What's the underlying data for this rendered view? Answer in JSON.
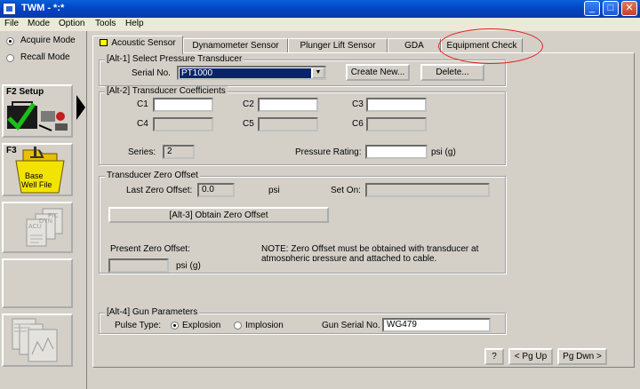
{
  "window": {
    "title": "TWM - *:*",
    "min": "_",
    "max": "□",
    "close": "✕"
  },
  "menu": [
    "File",
    "Mode",
    "Option",
    "Tools",
    "Help"
  ],
  "sidebar": {
    "acquire_label": "Acquire Mode",
    "recall_label": "Recall Mode",
    "setup_label": "F2 Setup",
    "basewell_key": "F3",
    "basewell_label_1": "Base",
    "basewell_label_2": "Well File"
  },
  "tabs": [
    "Acoustic Sensor",
    "Dynamometer Sensor",
    "Plunger Lift Sensor",
    "GDA",
    "Equipment Check"
  ],
  "pressure": {
    "legend": "[Alt-1]  Select Pressure Transducer",
    "serial_label": "Serial No.",
    "serial_value": "PT1000",
    "create_button": "Create New...",
    "delete_button": "Delete..."
  },
  "coefficients": {
    "legend": "[Alt-2]  Transducer Coefficients",
    "c1": "C1",
    "c2": "C2",
    "c3": "C3",
    "c4": "C4",
    "c5": "C5",
    "c6": "C6",
    "series_label": "Series:",
    "series_value": "2",
    "rating_label": "Pressure Rating:",
    "rating_unit": "psi (g)"
  },
  "zero_offset": {
    "legend": "Transducer Zero Offset",
    "last_label": "Last Zero Offset:",
    "last_value": "0.0",
    "last_unit": "psi",
    "set_on_label": "Set On:",
    "obtain_button": "[Alt-3]  Obtain Zero Offset",
    "present_label": "Present Zero Offset:",
    "present_unit": "psi (g)",
    "note_line1": "NOTE:  Zero Offset must be obtained with transducer at",
    "note_line2": "atmospheric pressure and attached to cable."
  },
  "gun": {
    "legend": "[Alt-4]  Gun Parameters",
    "pulse_label": "Pulse Type:",
    "explosion_label": "Explosion",
    "implosion_label": "Implosion",
    "serial_label": "Gun Serial No.",
    "serial_value": "WG479"
  },
  "footer": {
    "help_button": "?",
    "pgup_button": "< Pg Up",
    "pgdn_button": "Pg Dwn >"
  }
}
